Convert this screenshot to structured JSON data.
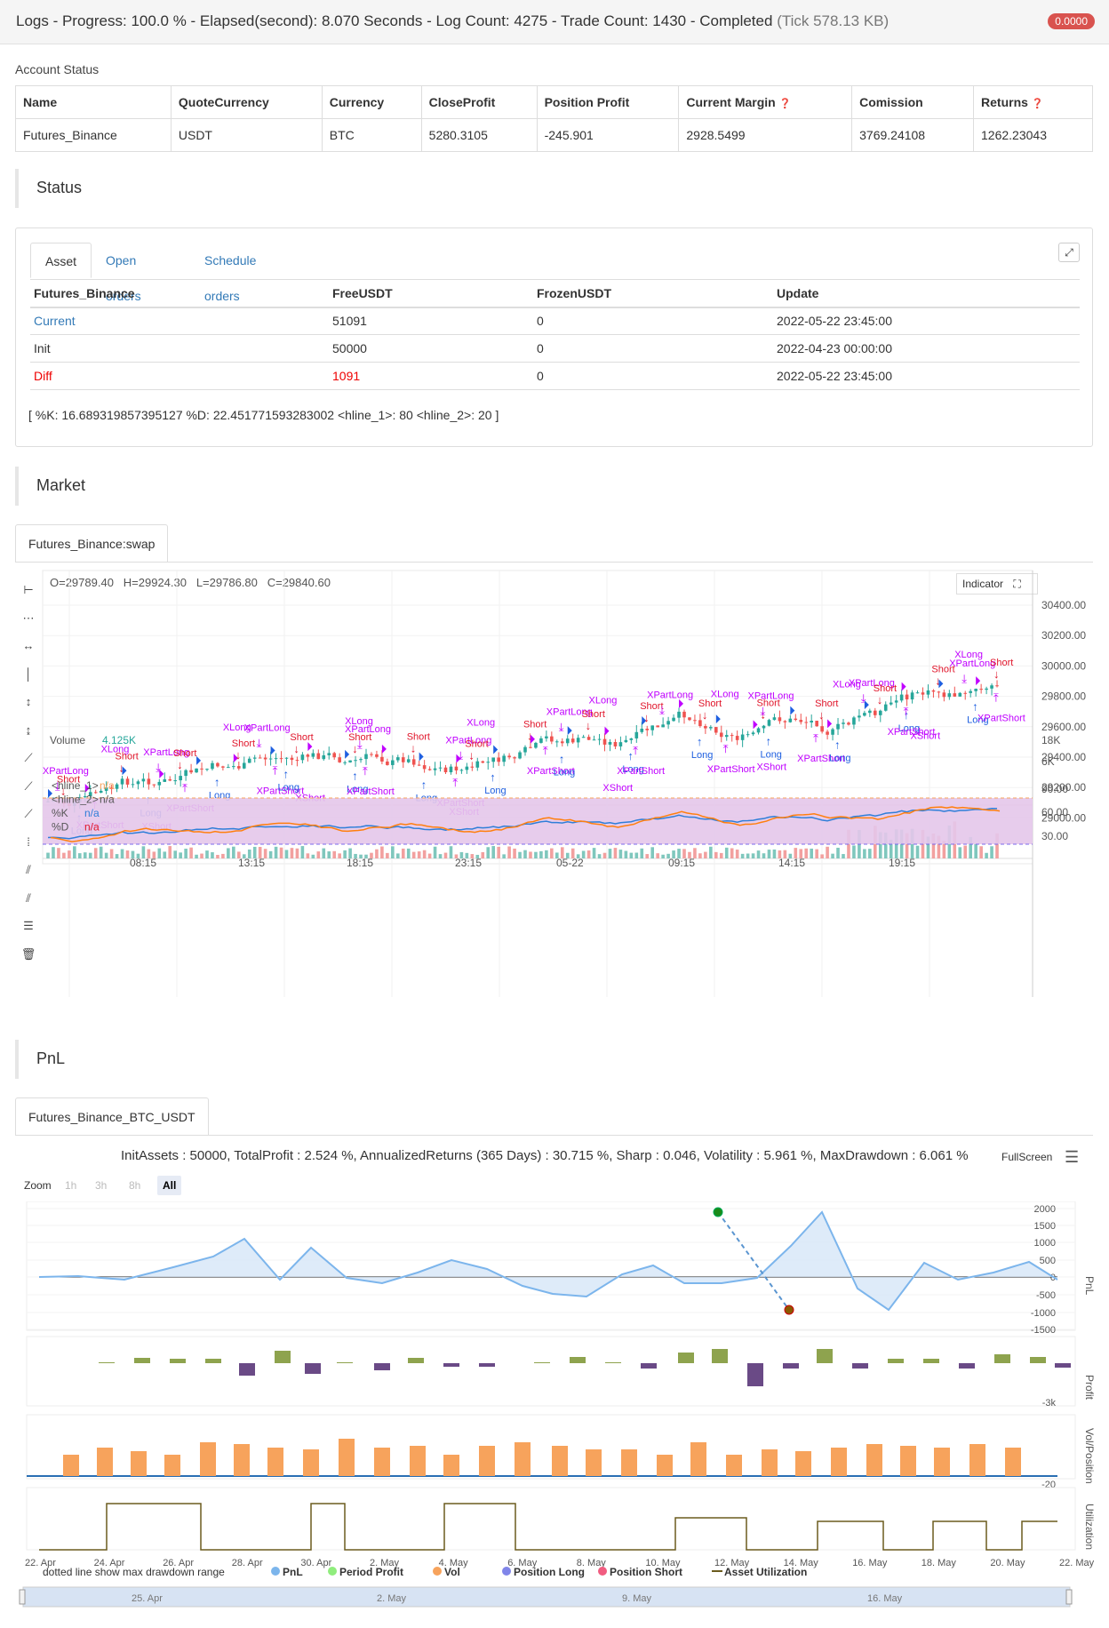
{
  "header": {
    "title": "Logs - Progress: 100.0 % - Elapsed(second): 8.070 Seconds - Log Count: 4275 - Trade Count: 1430 - Completed",
    "tick": "(Tick 578.13 KB)",
    "badge": "0.0000"
  },
  "account": {
    "label": "Account Status",
    "columns": [
      "Name",
      "QuoteCurrency",
      "Currency",
      "CloseProfit",
      "Position Profit",
      "Current Margin",
      "Comission",
      "Returns"
    ],
    "row": [
      "Futures_Binance",
      "USDT",
      "BTC",
      "5280.3105",
      "-245.901",
      "2928.5499",
      "3769.24108",
      "1262.23043"
    ]
  },
  "status": {
    "title": "Status",
    "tabs": [
      "Asset",
      "Open orders",
      "Schedule orders"
    ],
    "columns": [
      "Futures_Binance",
      "FreeUSDT",
      "FrozenUSDT",
      "Update"
    ],
    "rows": [
      [
        "Current",
        "51091",
        "0",
        "2022-05-22 23:45:00"
      ],
      [
        "Init",
        "50000",
        "0",
        "2022-04-23 00:00:00"
      ],
      [
        "Diff",
        "1091",
        "0",
        "2022-05-22 23:45:00"
      ]
    ],
    "info": "[ %K: 16.689319857395127 %D: 22.451771593283002 <hline_1>: 80 <hline_2>: 20 ]"
  },
  "market": {
    "title": "Market",
    "tab": "Futures_Binance:swap",
    "ohlc": {
      "o": "O=29789.40",
      "h": "H=29924.30",
      "l": "L=29786.80",
      "c": "C=29840.60"
    },
    "indicator_btn": "Indicator",
    "price_ticks": [
      "30400.00",
      "30200.00",
      "30000.00",
      "29800.00",
      "29600.00",
      "29400.00",
      "29200.00",
      "29000.00"
    ],
    "vol_ticks": [
      "18K",
      "6K"
    ],
    "vol_label": "Volume",
    "vol_value": "4.125K",
    "osc_ticks": [
      "90.00",
      "60.00",
      "30.00"
    ],
    "osc_legend": [
      {
        "name": "<hline_1>",
        "val": "n/a"
      },
      {
        "name": "<hline_2>",
        "val": "n/a"
      },
      {
        "name": "%K",
        "val": "n/a"
      },
      {
        "name": "%D",
        "val": "n/a"
      }
    ],
    "time_ticks": [
      "08:15",
      "13:15",
      "18:15",
      "23:15",
      "05-22",
      "09:15",
      "14:15",
      "19:15"
    ],
    "signal_labels": {
      "short": "Short",
      "long": "Long",
      "xlong": "XLong",
      "xshort": "XShort",
      "xpartlong": "XPartLong",
      "xpartshort": "XPartShort"
    }
  },
  "pnl": {
    "title": "PnL",
    "tab": "Futures_Binance_BTC_USDT",
    "stats": "InitAssets : 50000, TotalProfit : 2.524 %, AnnualizedReturns (365 Days) : 30.715 %, Sharp : 0.046, Volatility : 5.961 %, MaxDrawdown : 6.061 %",
    "fullscreen": "FullScreen",
    "zoom_label": "Zoom",
    "zoom_buttons": [
      "1h",
      "3h",
      "8h",
      "All"
    ],
    "pnl_ticks": [
      "2000",
      "1500",
      "1000",
      "500",
      "0",
      "-500",
      "-1000",
      "-1500"
    ],
    "pnl_axis": "PnL",
    "profit_axis": "Profit",
    "profit_tick": "-3k",
    "vol_axis": "Vol/Position",
    "vol_tick": "-20",
    "util_axis": "Utilization",
    "date_ticks": [
      "22. Apr",
      "24. Apr",
      "26. Apr",
      "28. Apr",
      "30. Apr",
      "2. May",
      "4. May",
      "6. May",
      "8. May",
      "10. May",
      "12. May",
      "14. May",
      "16. May",
      "18. May",
      "20. May",
      "22. May"
    ],
    "nav_ticks": [
      "25. Apr",
      "2. May",
      "9. May",
      "16. May"
    ],
    "footnote": "dotted line show max drawdown range",
    "legend": [
      "PnL",
      "Period Profit",
      "Vol",
      "Position Long",
      "Position Short",
      "Asset Utilization"
    ],
    "colors": {
      "pnl": "#7cb5ec",
      "profit": "#90ed7d",
      "vol": "#f7a35c",
      "long": "#8085e9",
      "short": "#f15c80",
      "util": "#6b5b1e"
    }
  }
}
